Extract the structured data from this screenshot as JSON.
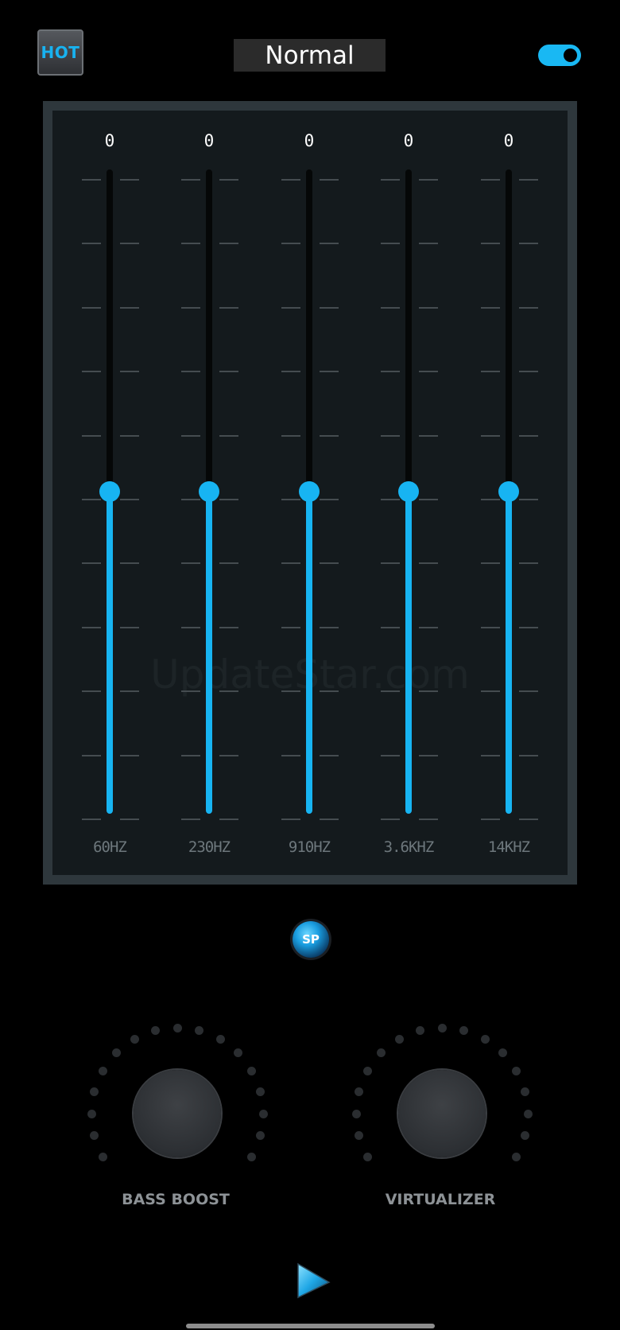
{
  "header": {
    "hot_label": "HOT",
    "preset_name": "Normal",
    "toggle_on": true
  },
  "equalizer": {
    "watermark": "UpdateStar.com",
    "bands": [
      {
        "label": "60HZ",
        "value": "0",
        "level": 0.5
      },
      {
        "label": "230HZ",
        "value": "0",
        "level": 0.5
      },
      {
        "label": "910HZ",
        "value": "0",
        "level": 0.5
      },
      {
        "label": "3.6KHZ",
        "value": "0",
        "level": 0.5
      },
      {
        "label": "14KHZ",
        "value": "0",
        "level": 0.5
      }
    ]
  },
  "sp_label": "SP",
  "knobs": [
    {
      "label": "BASS BOOST"
    },
    {
      "label": "VIRTUALIZER"
    }
  ],
  "colors": {
    "accent": "#17b4f2",
    "background": "#000000",
    "panel": "#141a1d"
  }
}
